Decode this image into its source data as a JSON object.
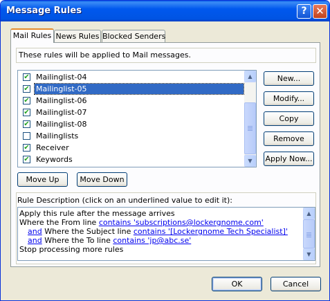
{
  "window": {
    "title": "Message Rules",
    "help_glyph": "?",
    "close_glyph": "✕"
  },
  "tabs": [
    {
      "label": "Mail Rules",
      "active": true
    },
    {
      "label": "News Rules",
      "active": false
    },
    {
      "label": "Blocked Senders",
      "active": false
    }
  ],
  "intro_text": "These rules will be applied to Mail messages.",
  "rules": [
    {
      "name": "Mailinglist-04",
      "checked": true,
      "selected": false
    },
    {
      "name": "Mailinglist-05",
      "checked": true,
      "selected": true
    },
    {
      "name": "Mailinglist-06",
      "checked": true,
      "selected": false
    },
    {
      "name": "Mailinglist-07",
      "checked": true,
      "selected": false
    },
    {
      "name": "Mailinglist-08",
      "checked": true,
      "selected": false
    },
    {
      "name": "Mailinglists",
      "checked": false,
      "selected": false
    },
    {
      "name": "Receiver",
      "checked": true,
      "selected": false
    },
    {
      "name": "Keywords",
      "checked": true,
      "selected": false
    }
  ],
  "side_buttons": {
    "new": "New...",
    "modify": "Modify...",
    "copy": "Copy",
    "remove": "Remove",
    "apply_now": "Apply Now..."
  },
  "move_buttons": {
    "up": "Move Up",
    "down": "Move Down"
  },
  "description_label": "Rule Description (click on an underlined value to edit it):",
  "description": {
    "line1": "Apply this rule after the message arrives",
    "line2_prefix": "Where the From line ",
    "line2_link": "contains 'subscriptions@lockergnome.com'",
    "line3_and": "and",
    "line3_text": " Where the Subject line ",
    "line3_link": "contains '[Lockergnome Tech Specialist]'",
    "line4_and": "and",
    "line4_text": " Where the To line ",
    "line4_link": "contains 'jp@abc.se'",
    "line5": "Stop processing more rules"
  },
  "footer": {
    "ok": "OK",
    "cancel": "Cancel"
  },
  "colors": {
    "titlebar": "#0054e3",
    "selection": "#316ac5",
    "link": "#0000ee",
    "dialog_bg": "#ece9d8"
  }
}
